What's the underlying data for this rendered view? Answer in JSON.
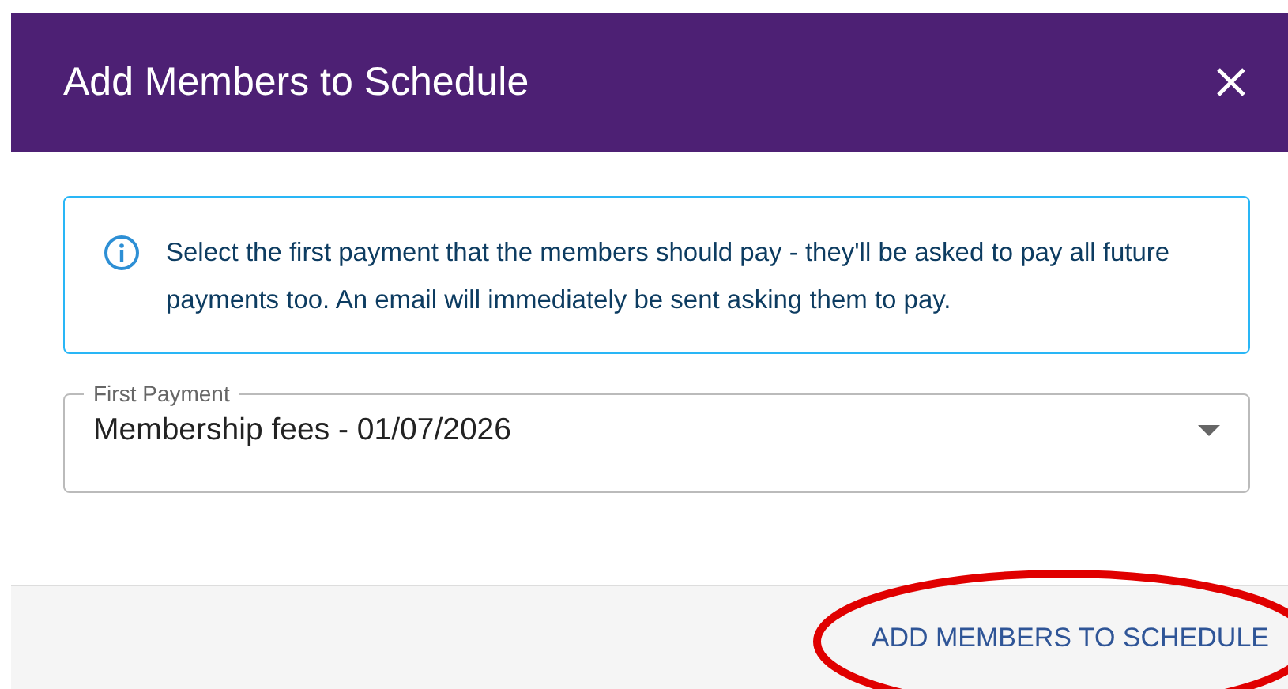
{
  "dialog": {
    "title": "Add Members to Schedule"
  },
  "info": {
    "text": "Select the first payment that the members should pay - they'll be asked to pay all future payments too. An email will immediately be sent asking them to pay."
  },
  "field": {
    "label": "First Payment",
    "value": "Membership fees - 01/07/2026"
  },
  "footer_buttons": [
    "ADD MEMBERS TO SCHEDULE"
  ],
  "annotations": [
    {
      "kind": "ellipse",
      "color": "#e00000"
    }
  ]
}
